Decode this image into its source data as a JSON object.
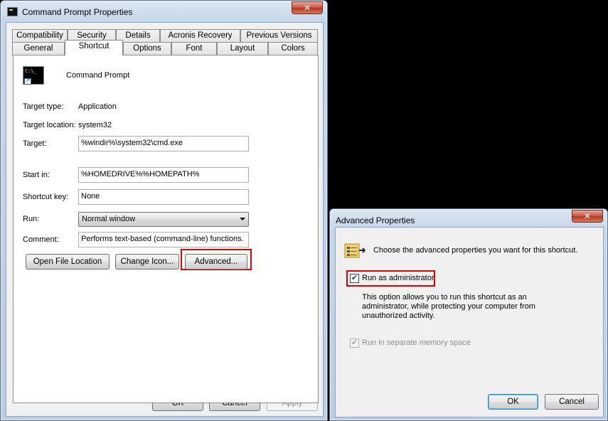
{
  "main_window": {
    "title": "Command Prompt Properties",
    "close_label": "✕",
    "tabs_row1": [
      "Compatibility",
      "Security",
      "Details",
      "Acronis Recovery",
      "Previous Versions"
    ],
    "tabs_row2": [
      "General",
      "Shortcut",
      "Options",
      "Font",
      "Layout",
      "Colors"
    ],
    "active_tab": "Shortcut",
    "shortcut": {
      "name": "Command Prompt",
      "target_type_label": "Target type:",
      "target_type_value": "Application",
      "target_location_label": "Target location:",
      "target_location_value": "system32",
      "target_label": "Target:",
      "target_value": "%windir%\\system32\\cmd.exe",
      "start_in_label": "Start in:",
      "start_in_value": "%HOMEDRIVE%%HOMEPATH%",
      "shortcut_key_label": "Shortcut key:",
      "shortcut_key_value": "None",
      "run_label": "Run:",
      "run_value": "Normal window",
      "comment_label": "Comment:",
      "comment_value": "Performs text-based (command-line) functions.",
      "open_file_location": "Open File Location",
      "change_icon": "Change Icon...",
      "advanced": "Advanced..."
    },
    "ok": "OK",
    "cancel": "Cancel",
    "apply": "Apply"
  },
  "advanced_window": {
    "title": "Advanced Properties",
    "close_label": "✕",
    "description": "Choose the advanced properties you want for this shortcut.",
    "run_as_admin_label": "Run as administrator",
    "run_as_admin_checked": true,
    "run_as_admin_help": "This option allows you to run this shortcut as an administrator, while protecting your computer from unauthorized activity.",
    "separate_memory_label": "Run in separate memory space",
    "separate_memory_checked": true,
    "separate_memory_enabled": false,
    "ok": "OK",
    "cancel": "Cancel"
  },
  "colors": {
    "highlight": "#e00000",
    "background": "#000000"
  }
}
